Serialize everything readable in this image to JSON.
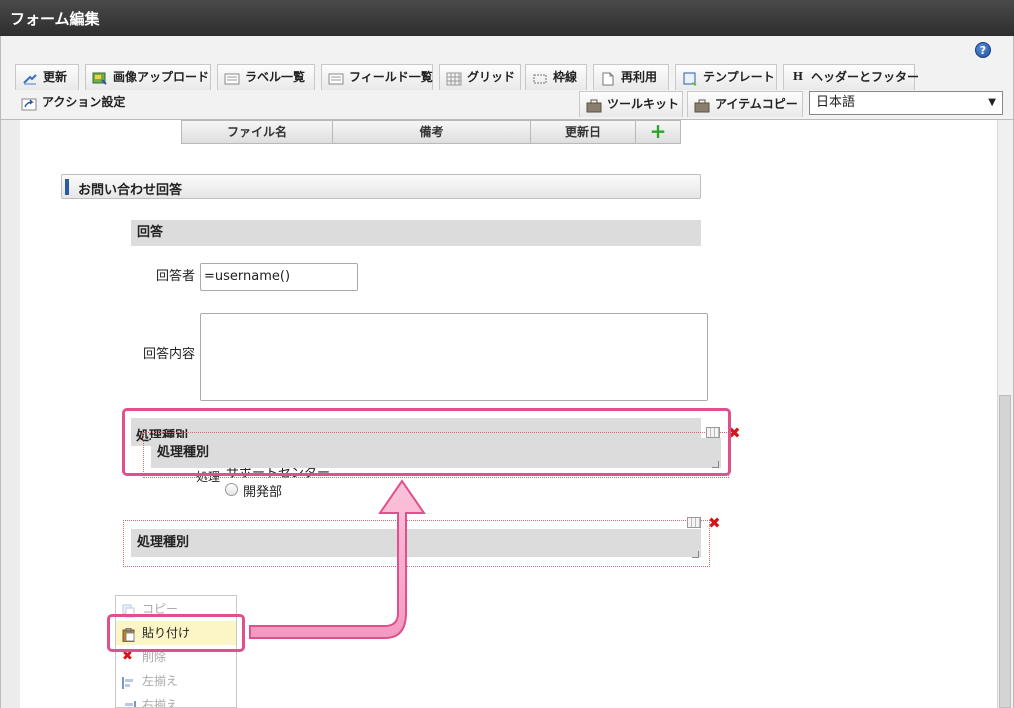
{
  "window": {
    "title": "フォーム編集"
  },
  "toolbar": {
    "row1": [
      {
        "label": "更新",
        "icon": "update-icon"
      },
      {
        "label": "画像アップロード",
        "icon": "image-upload-icon"
      },
      {
        "label": "ラベル一覧",
        "icon": "label-list-icon"
      },
      {
        "label": "フィールド一覧",
        "icon": "field-list-icon"
      },
      {
        "label": "グリッド",
        "icon": "grid-icon"
      },
      {
        "label": "枠線",
        "icon": "border-icon"
      },
      {
        "label": "再利用",
        "icon": "reuse-icon"
      },
      {
        "label": "テンプレート",
        "icon": "template-icon"
      },
      {
        "label": "ヘッダーとフッター",
        "icon": "header-footer-icon"
      }
    ],
    "row2": [
      {
        "label": "アクション設定",
        "icon": "action-settings-icon"
      },
      {
        "label": "ツールキット",
        "icon": "toolkit-icon"
      },
      {
        "label": "アイテムコピー",
        "icon": "item-copy-icon"
      }
    ],
    "language": {
      "selected": "日本語"
    },
    "help_glyph": "?"
  },
  "table": {
    "columns": [
      "ファイル名",
      "備考",
      "更新日"
    ],
    "add_glyph": "+"
  },
  "form": {
    "section_title": "お問い合わせ回答",
    "subsection_title": "回答",
    "responder_label": "回答者",
    "responder_value": "=username()",
    "content_label": "回答内容",
    "dragged_label_outer": "処理種別",
    "dragged_label_inner": "処理種別",
    "radio_label_fragment": "処理",
    "radio_option_partial": "サポートセンター",
    "radio_option_2": "開発部",
    "pasted_label": "処理種別"
  },
  "context_menu": {
    "items": [
      {
        "label": "コピー",
        "icon": "copy-icon",
        "enabled": false
      },
      {
        "label": "貼り付け",
        "icon": "paste-icon",
        "enabled": true
      },
      {
        "label": "削除",
        "icon": "delete-icon",
        "enabled": false
      },
      {
        "label": "左揃え",
        "icon": "align-left-icon",
        "enabled": false
      },
      {
        "label": "右揃え",
        "icon": "align-right-icon",
        "enabled": false
      }
    ]
  },
  "colors": {
    "accent_pink": "#e0508c",
    "title_bar": "#3a3a3a",
    "selection_red": "#d46a6a"
  }
}
